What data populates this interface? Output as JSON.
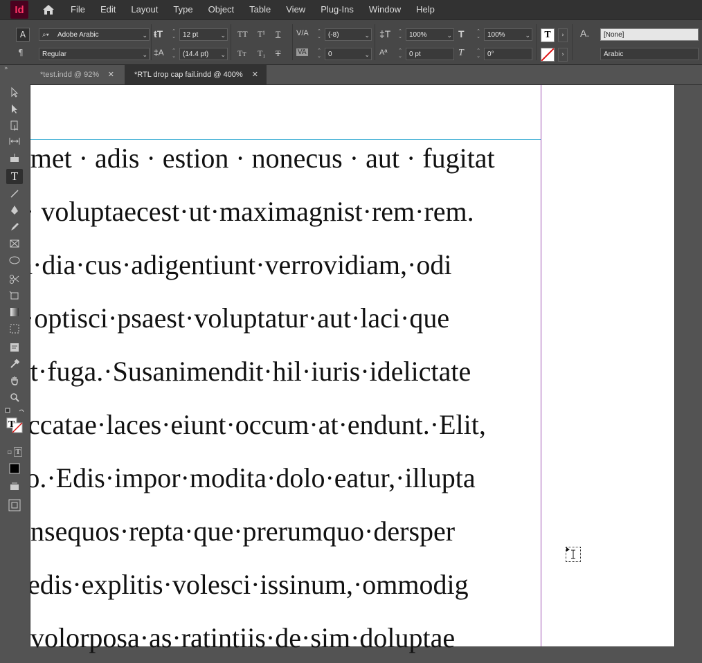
{
  "app": {
    "logo": "Id"
  },
  "menu": [
    "File",
    "Edit",
    "Layout",
    "Type",
    "Object",
    "Table",
    "View",
    "Plug-Ins",
    "Window",
    "Help"
  ],
  "control": {
    "font_family": "Adobe Arabic",
    "font_style": "Regular",
    "font_size": "12 pt",
    "leading": "(14.4 pt)",
    "kerning": "(-8)",
    "tracking": "0",
    "horizontal_scale": "100%",
    "vertical_scale": "100%",
    "baseline_shift": "0 pt",
    "skew": "0°",
    "char_style": "[None]",
    "language": "Arabic"
  },
  "tabs": [
    {
      "label": "*test.indd @ 92%",
      "active": false
    },
    {
      "label": "*RTL drop cap fail.indd @ 400%",
      "active": true
    }
  ],
  "document": {
    "lines": [
      "amet · adis · estion · nonecus · aut · fugitat",
      "· voluptaecest·ut·maximagnist·rem·rem.",
      "m·dia·cus·adigentiunt·verrovidiam,·odi",
      "·optisci·psaest·voluptatur·aut·laci·que",
      "at·fuga.·Susanimendit·hil·iuris·idelictate",
      "occatae·laces·eiunt·occum·at·endunt.·Elit,",
      "ro.·Edis·impor·modita·dolo·eatur,·illupta",
      "onsequos·repta·que·prerumquo·dersper",
      "edis·explitis·volesci·issinum,·ommodig",
      "volorposa·as·ratintiis·de·sim·doluptae"
    ]
  }
}
